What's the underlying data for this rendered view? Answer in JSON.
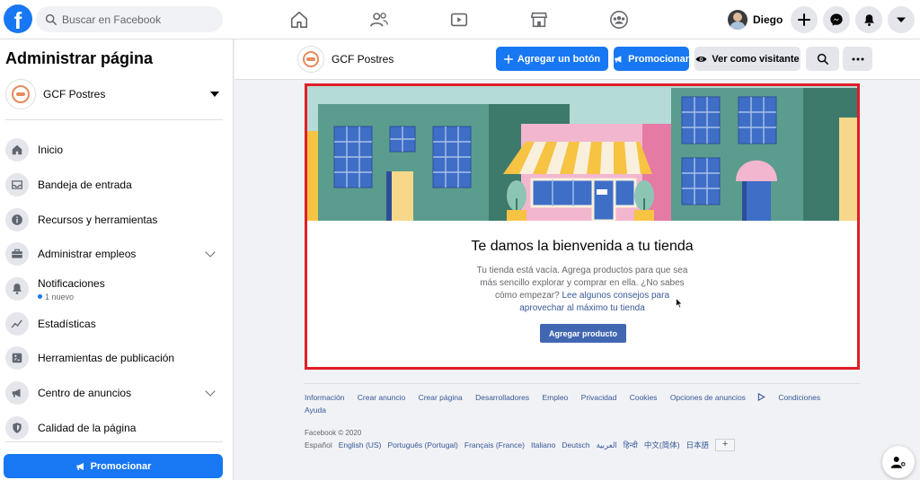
{
  "topbar": {
    "logo_letter": "f",
    "search_placeholder": "Buscar en Facebook",
    "user_name": "Diego",
    "nav_icons": [
      "home-icon",
      "friends-icon",
      "watch-icon",
      "marketplace-icon",
      "groups-icon"
    ],
    "action_icons": [
      "plus-icon",
      "messenger-icon",
      "notifications-icon",
      "account-menu-icon"
    ],
    "brand_color": "#1877f2"
  },
  "sidebar": {
    "title": "Administrar página",
    "page_name": "GCF Postres",
    "items": [
      {
        "label": "Inicio",
        "icon": "home-icon"
      },
      {
        "label": "Bandeja de entrada",
        "icon": "inbox-icon"
      },
      {
        "label": "Recursos y herramientas",
        "icon": "info-icon"
      },
      {
        "label": "Administrar empleos",
        "icon": "briefcase-icon",
        "expandable": true
      },
      {
        "label": "Notificaciones",
        "sub": "1 nuevo",
        "icon": "bell-icon"
      },
      {
        "label": "Estadísticas",
        "icon": "chart-icon"
      },
      {
        "label": "Herramientas de publicación",
        "icon": "tools-icon"
      },
      {
        "label": "Centro de anuncios",
        "icon": "megaphone-icon",
        "expandable": true
      },
      {
        "label": "Calidad de la página",
        "icon": "shield-icon"
      }
    ],
    "promote_label": "Promocionar"
  },
  "header": {
    "page_name": "GCF Postres",
    "add_button_label": "Agregar un botón",
    "promote_label": "Promocionar",
    "view_as_label": "Ver como visitante"
  },
  "shop": {
    "title": "Te damos la bienvenida a tu tienda",
    "desc_text": "Tu tienda está vacía. Agrega productos para que sea más sencillo explorar y comprar en ella. ¿No sabes cómo empezar? ",
    "desc_link": "Lee algunos consejos para aprovechar al máximo tu tienda",
    "add_product_label": "Agregar producto",
    "highlight_color": "#e01e27"
  },
  "footer": {
    "links": [
      "Información",
      "Crear anuncio",
      "Crear página",
      "Desarrolladores",
      "Empleo",
      "Privacidad",
      "Cookies",
      "Opciones de anuncios",
      "Condiciones",
      "Ayuda"
    ],
    "copyright": "Facebook © 2020",
    "languages": [
      "Español",
      "English (US)",
      "Português (Portugal)",
      "Français (France)",
      "Italiano",
      "Deutsch",
      "العربية",
      "हिन्दी",
      "中文(简体)",
      "日本語"
    ],
    "lang_plus": "+"
  }
}
